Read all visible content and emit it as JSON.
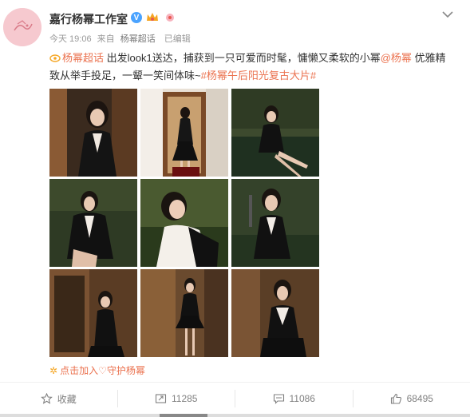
{
  "post": {
    "author": "嘉行杨幂工作室",
    "verified_badge": "V",
    "time": "今天 19:06",
    "from_label": "来自",
    "source": "杨幂超话",
    "edited": "已编辑",
    "supertopic_tag": "杨幂超话",
    "text_part1": " 出发look1送达，捕获到一只可爱而时髦，慵懒又柔软的小幂",
    "mention": "@杨幂",
    "text_part2": " 优雅精致从举手投足，一颦一笑间体味~",
    "hashtag": "#杨幂午后阳光复古大片#",
    "fan_action": "点击加入♡守护杨幂"
  },
  "actions": {
    "favorite": "收藏",
    "repost": "11285",
    "comment": "11086",
    "like": "68495"
  },
  "photos": [
    {
      "name": "photo-1"
    },
    {
      "name": "photo-2"
    },
    {
      "name": "photo-3"
    },
    {
      "name": "photo-4"
    },
    {
      "name": "photo-5"
    },
    {
      "name": "photo-6"
    },
    {
      "name": "photo-7"
    },
    {
      "name": "photo-8"
    },
    {
      "name": "photo-9"
    }
  ],
  "colors": {
    "link": "#eb7350",
    "meta": "#999999",
    "avatar_bg": "#f6c9cf",
    "verified": "#4aa3ff"
  }
}
